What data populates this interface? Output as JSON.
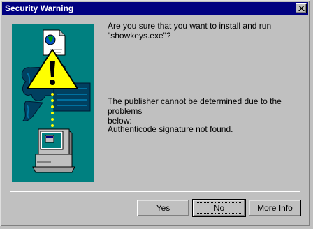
{
  "window": {
    "title": "Security Warning"
  },
  "message": {
    "question_line1": "Are you sure that you want to install and run",
    "question_line2": "\"showkeys.exe\"?",
    "publisher_line1": "The publisher cannot be determined due to the problems",
    "publisher_line2": "below:",
    "signature": "Authenticode signature not found."
  },
  "buttons": {
    "yes_accel": "Y",
    "yes_rest": "es",
    "no_accel": "N",
    "no_rest": "o",
    "more_info_label": "More Info"
  },
  "colors": {
    "titlebar": "#000080",
    "illustration_bg": "#008080",
    "warning_yellow": "#ffff00",
    "face": "#c0c0c0"
  },
  "icons": [
    "close-icon",
    "document-icon",
    "globe-icon",
    "warning-icon",
    "seal-icon",
    "computer-icon"
  ]
}
